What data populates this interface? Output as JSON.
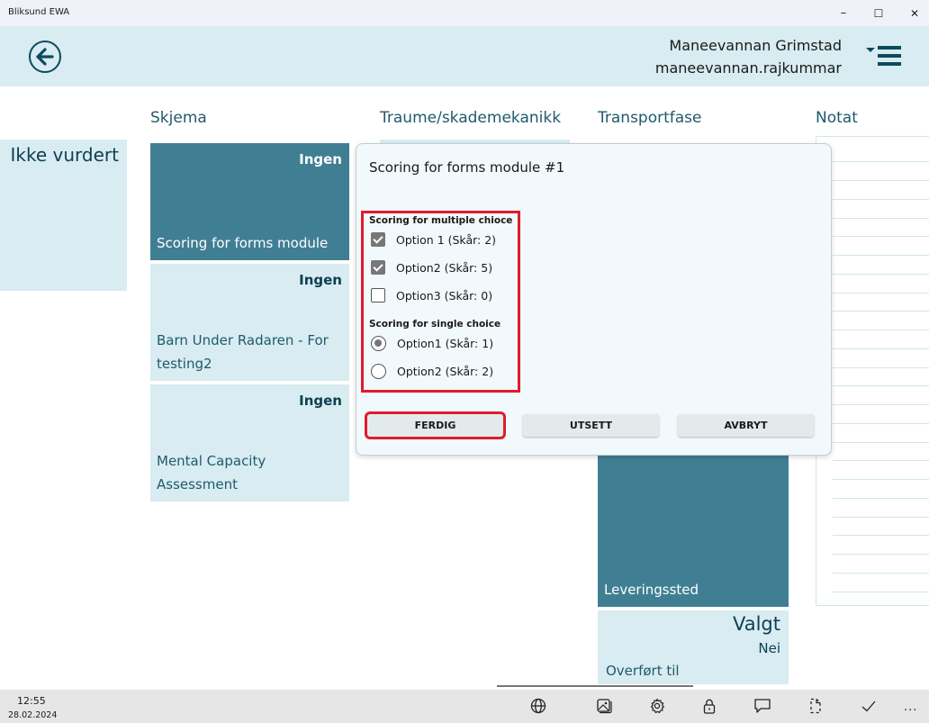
{
  "window": {
    "title": "Bliksund EWA",
    "controls": {
      "minimize": "–",
      "maximize": "☐",
      "close": "✕"
    }
  },
  "header": {
    "back_icon": "back-arrow-icon",
    "user_full_name": "Maneevannan Grimstad",
    "user_login": "maneevannan.rajkummar",
    "menu_icon": "hamburger-menu-icon"
  },
  "status": {
    "label": "Ikke vurdert"
  },
  "columns": {
    "skjema": "Skjema",
    "traume": "Traume/skademekanikk",
    "transport": "Transportfase",
    "notat": "Notat"
  },
  "skjema_tiles": [
    {
      "badge": "Ingen",
      "label": "Scoring for forms module",
      "selected": true
    },
    {
      "badge": "Ingen",
      "label": "Barn Under Radaren - For testing2",
      "selected": false
    },
    {
      "badge": "Ingen",
      "label": "Mental Capacity Assessment",
      "selected": false
    }
  ],
  "transport_tiles": [
    {
      "label": "Leveringssted",
      "selected": true
    },
    {
      "badge": "Valgt",
      "sub": "Nei",
      "label": "Overført til",
      "selected": false
    }
  ],
  "dialog": {
    "title": "Scoring for forms module #1",
    "multiple_choice": {
      "title": "Scoring for multiple chioce",
      "options": [
        {
          "label": "Option 1 (Skår: 2)",
          "checked": true
        },
        {
          "label": "Option2 (Skår: 5)",
          "checked": true
        },
        {
          "label": "Option3 (Skår: 0)",
          "checked": false
        }
      ]
    },
    "single_choice": {
      "title": "Scoring for single choice",
      "options": [
        {
          "label": "Option1 (Skår: 1)",
          "selected": true
        },
        {
          "label": "Option2 (Skår: 2)",
          "selected": false
        }
      ]
    },
    "buttons": {
      "done": "FERDIG",
      "postpone": "UTSETT",
      "cancel": "AVBRYT"
    },
    "highlight_color": "#e01b2c"
  },
  "taskbar": {
    "time": "12:55",
    "date": "28.02.2024",
    "icons": [
      "globe-icon",
      "gallery-icon",
      "settings-gear-icon",
      "lock-icon",
      "chat-bubble-icon",
      "document-crop-icon",
      "checkmark-icon"
    ],
    "more": "..."
  },
  "colors": {
    "accent_dark": "#0d4a5e",
    "tile_light": "#d8ecf1",
    "tile_selected": "#407f93"
  }
}
